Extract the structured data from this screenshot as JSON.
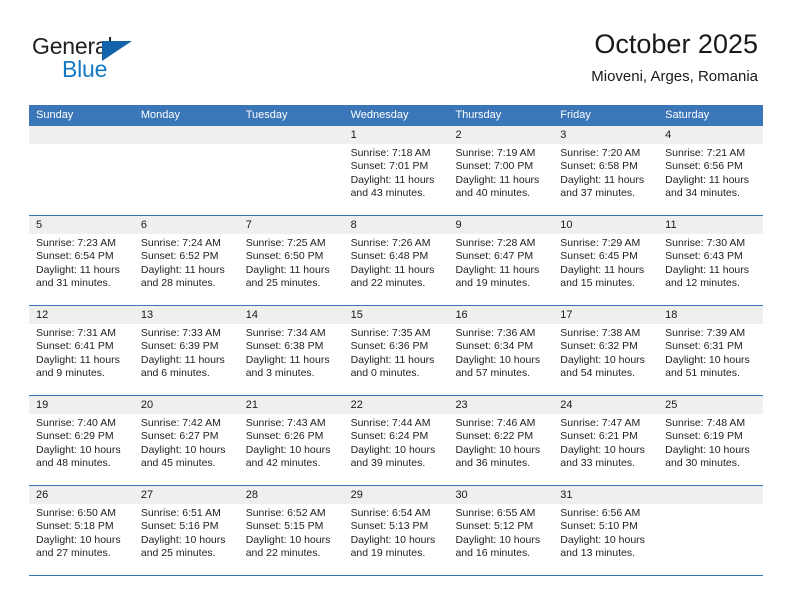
{
  "brand": {
    "name_part1": "General",
    "name_part2": "Blue",
    "accent_color": "#1479c4",
    "triangle_color": "#1263a8"
  },
  "header": {
    "title": "October 2025",
    "subtitle": "Mioveni, Arges, Romania"
  },
  "calendar": {
    "header_bg": "#3a76b8",
    "datebar_bg": "#efefef",
    "weekdays": [
      "Sunday",
      "Monday",
      "Tuesday",
      "Wednesday",
      "Thursday",
      "Friday",
      "Saturday"
    ],
    "labels": {
      "sunrise": "Sunrise:",
      "sunset": "Sunset:",
      "daylight": "Daylight:"
    },
    "weeks": [
      [
        {
          "day": ""
        },
        {
          "day": ""
        },
        {
          "day": ""
        },
        {
          "day": "1",
          "sunrise": "Sunrise: 7:18 AM",
          "sunset": "Sunset: 7:01 PM",
          "daylight_line1": "Daylight: 11 hours",
          "daylight_line2": "and 43 minutes."
        },
        {
          "day": "2",
          "sunrise": "Sunrise: 7:19 AM",
          "sunset": "Sunset: 7:00 PM",
          "daylight_line1": "Daylight: 11 hours",
          "daylight_line2": "and 40 minutes."
        },
        {
          "day": "3",
          "sunrise": "Sunrise: 7:20 AM",
          "sunset": "Sunset: 6:58 PM",
          "daylight_line1": "Daylight: 11 hours",
          "daylight_line2": "and 37 minutes."
        },
        {
          "day": "4",
          "sunrise": "Sunrise: 7:21 AM",
          "sunset": "Sunset: 6:56 PM",
          "daylight_line1": "Daylight: 11 hours",
          "daylight_line2": "and 34 minutes."
        }
      ],
      [
        {
          "day": "5",
          "sunrise": "Sunrise: 7:23 AM",
          "sunset": "Sunset: 6:54 PM",
          "daylight_line1": "Daylight: 11 hours",
          "daylight_line2": "and 31 minutes."
        },
        {
          "day": "6",
          "sunrise": "Sunrise: 7:24 AM",
          "sunset": "Sunset: 6:52 PM",
          "daylight_line1": "Daylight: 11 hours",
          "daylight_line2": "and 28 minutes."
        },
        {
          "day": "7",
          "sunrise": "Sunrise: 7:25 AM",
          "sunset": "Sunset: 6:50 PM",
          "daylight_line1": "Daylight: 11 hours",
          "daylight_line2": "and 25 minutes."
        },
        {
          "day": "8",
          "sunrise": "Sunrise: 7:26 AM",
          "sunset": "Sunset: 6:48 PM",
          "daylight_line1": "Daylight: 11 hours",
          "daylight_line2": "and 22 minutes."
        },
        {
          "day": "9",
          "sunrise": "Sunrise: 7:28 AM",
          "sunset": "Sunset: 6:47 PM",
          "daylight_line1": "Daylight: 11 hours",
          "daylight_line2": "and 19 minutes."
        },
        {
          "day": "10",
          "sunrise": "Sunrise: 7:29 AM",
          "sunset": "Sunset: 6:45 PM",
          "daylight_line1": "Daylight: 11 hours",
          "daylight_line2": "and 15 minutes."
        },
        {
          "day": "11",
          "sunrise": "Sunrise: 7:30 AM",
          "sunset": "Sunset: 6:43 PM",
          "daylight_line1": "Daylight: 11 hours",
          "daylight_line2": "and 12 minutes."
        }
      ],
      [
        {
          "day": "12",
          "sunrise": "Sunrise: 7:31 AM",
          "sunset": "Sunset: 6:41 PM",
          "daylight_line1": "Daylight: 11 hours",
          "daylight_line2": "and 9 minutes."
        },
        {
          "day": "13",
          "sunrise": "Sunrise: 7:33 AM",
          "sunset": "Sunset: 6:39 PM",
          "daylight_line1": "Daylight: 11 hours",
          "daylight_line2": "and 6 minutes."
        },
        {
          "day": "14",
          "sunrise": "Sunrise: 7:34 AM",
          "sunset": "Sunset: 6:38 PM",
          "daylight_line1": "Daylight: 11 hours",
          "daylight_line2": "and 3 minutes."
        },
        {
          "day": "15",
          "sunrise": "Sunrise: 7:35 AM",
          "sunset": "Sunset: 6:36 PM",
          "daylight_line1": "Daylight: 11 hours",
          "daylight_line2": "and 0 minutes."
        },
        {
          "day": "16",
          "sunrise": "Sunrise: 7:36 AM",
          "sunset": "Sunset: 6:34 PM",
          "daylight_line1": "Daylight: 10 hours",
          "daylight_line2": "and 57 minutes."
        },
        {
          "day": "17",
          "sunrise": "Sunrise: 7:38 AM",
          "sunset": "Sunset: 6:32 PM",
          "daylight_line1": "Daylight: 10 hours",
          "daylight_line2": "and 54 minutes."
        },
        {
          "day": "18",
          "sunrise": "Sunrise: 7:39 AM",
          "sunset": "Sunset: 6:31 PM",
          "daylight_line1": "Daylight: 10 hours",
          "daylight_line2": "and 51 minutes."
        }
      ],
      [
        {
          "day": "19",
          "sunrise": "Sunrise: 7:40 AM",
          "sunset": "Sunset: 6:29 PM",
          "daylight_line1": "Daylight: 10 hours",
          "daylight_line2": "and 48 minutes."
        },
        {
          "day": "20",
          "sunrise": "Sunrise: 7:42 AM",
          "sunset": "Sunset: 6:27 PM",
          "daylight_line1": "Daylight: 10 hours",
          "daylight_line2": "and 45 minutes."
        },
        {
          "day": "21",
          "sunrise": "Sunrise: 7:43 AM",
          "sunset": "Sunset: 6:26 PM",
          "daylight_line1": "Daylight: 10 hours",
          "daylight_line2": "and 42 minutes."
        },
        {
          "day": "22",
          "sunrise": "Sunrise: 7:44 AM",
          "sunset": "Sunset: 6:24 PM",
          "daylight_line1": "Daylight: 10 hours",
          "daylight_line2": "and 39 minutes."
        },
        {
          "day": "23",
          "sunrise": "Sunrise: 7:46 AM",
          "sunset": "Sunset: 6:22 PM",
          "daylight_line1": "Daylight: 10 hours",
          "daylight_line2": "and 36 minutes."
        },
        {
          "day": "24",
          "sunrise": "Sunrise: 7:47 AM",
          "sunset": "Sunset: 6:21 PM",
          "daylight_line1": "Daylight: 10 hours",
          "daylight_line2": "and 33 minutes."
        },
        {
          "day": "25",
          "sunrise": "Sunrise: 7:48 AM",
          "sunset": "Sunset: 6:19 PM",
          "daylight_line1": "Daylight: 10 hours",
          "daylight_line2": "and 30 minutes."
        }
      ],
      [
        {
          "day": "26",
          "sunrise": "Sunrise: 6:50 AM",
          "sunset": "Sunset: 5:18 PM",
          "daylight_line1": "Daylight: 10 hours",
          "daylight_line2": "and 27 minutes."
        },
        {
          "day": "27",
          "sunrise": "Sunrise: 6:51 AM",
          "sunset": "Sunset: 5:16 PM",
          "daylight_line1": "Daylight: 10 hours",
          "daylight_line2": "and 25 minutes."
        },
        {
          "day": "28",
          "sunrise": "Sunrise: 6:52 AM",
          "sunset": "Sunset: 5:15 PM",
          "daylight_line1": "Daylight: 10 hours",
          "daylight_line2": "and 22 minutes."
        },
        {
          "day": "29",
          "sunrise": "Sunrise: 6:54 AM",
          "sunset": "Sunset: 5:13 PM",
          "daylight_line1": "Daylight: 10 hours",
          "daylight_line2": "and 19 minutes."
        },
        {
          "day": "30",
          "sunrise": "Sunrise: 6:55 AM",
          "sunset": "Sunset: 5:12 PM",
          "daylight_line1": "Daylight: 10 hours",
          "daylight_line2": "and 16 minutes."
        },
        {
          "day": "31",
          "sunrise": "Sunrise: 6:56 AM",
          "sunset": "Sunset: 5:10 PM",
          "daylight_line1": "Daylight: 10 hours",
          "daylight_line2": "and 13 minutes."
        },
        {
          "day": ""
        }
      ]
    ]
  }
}
